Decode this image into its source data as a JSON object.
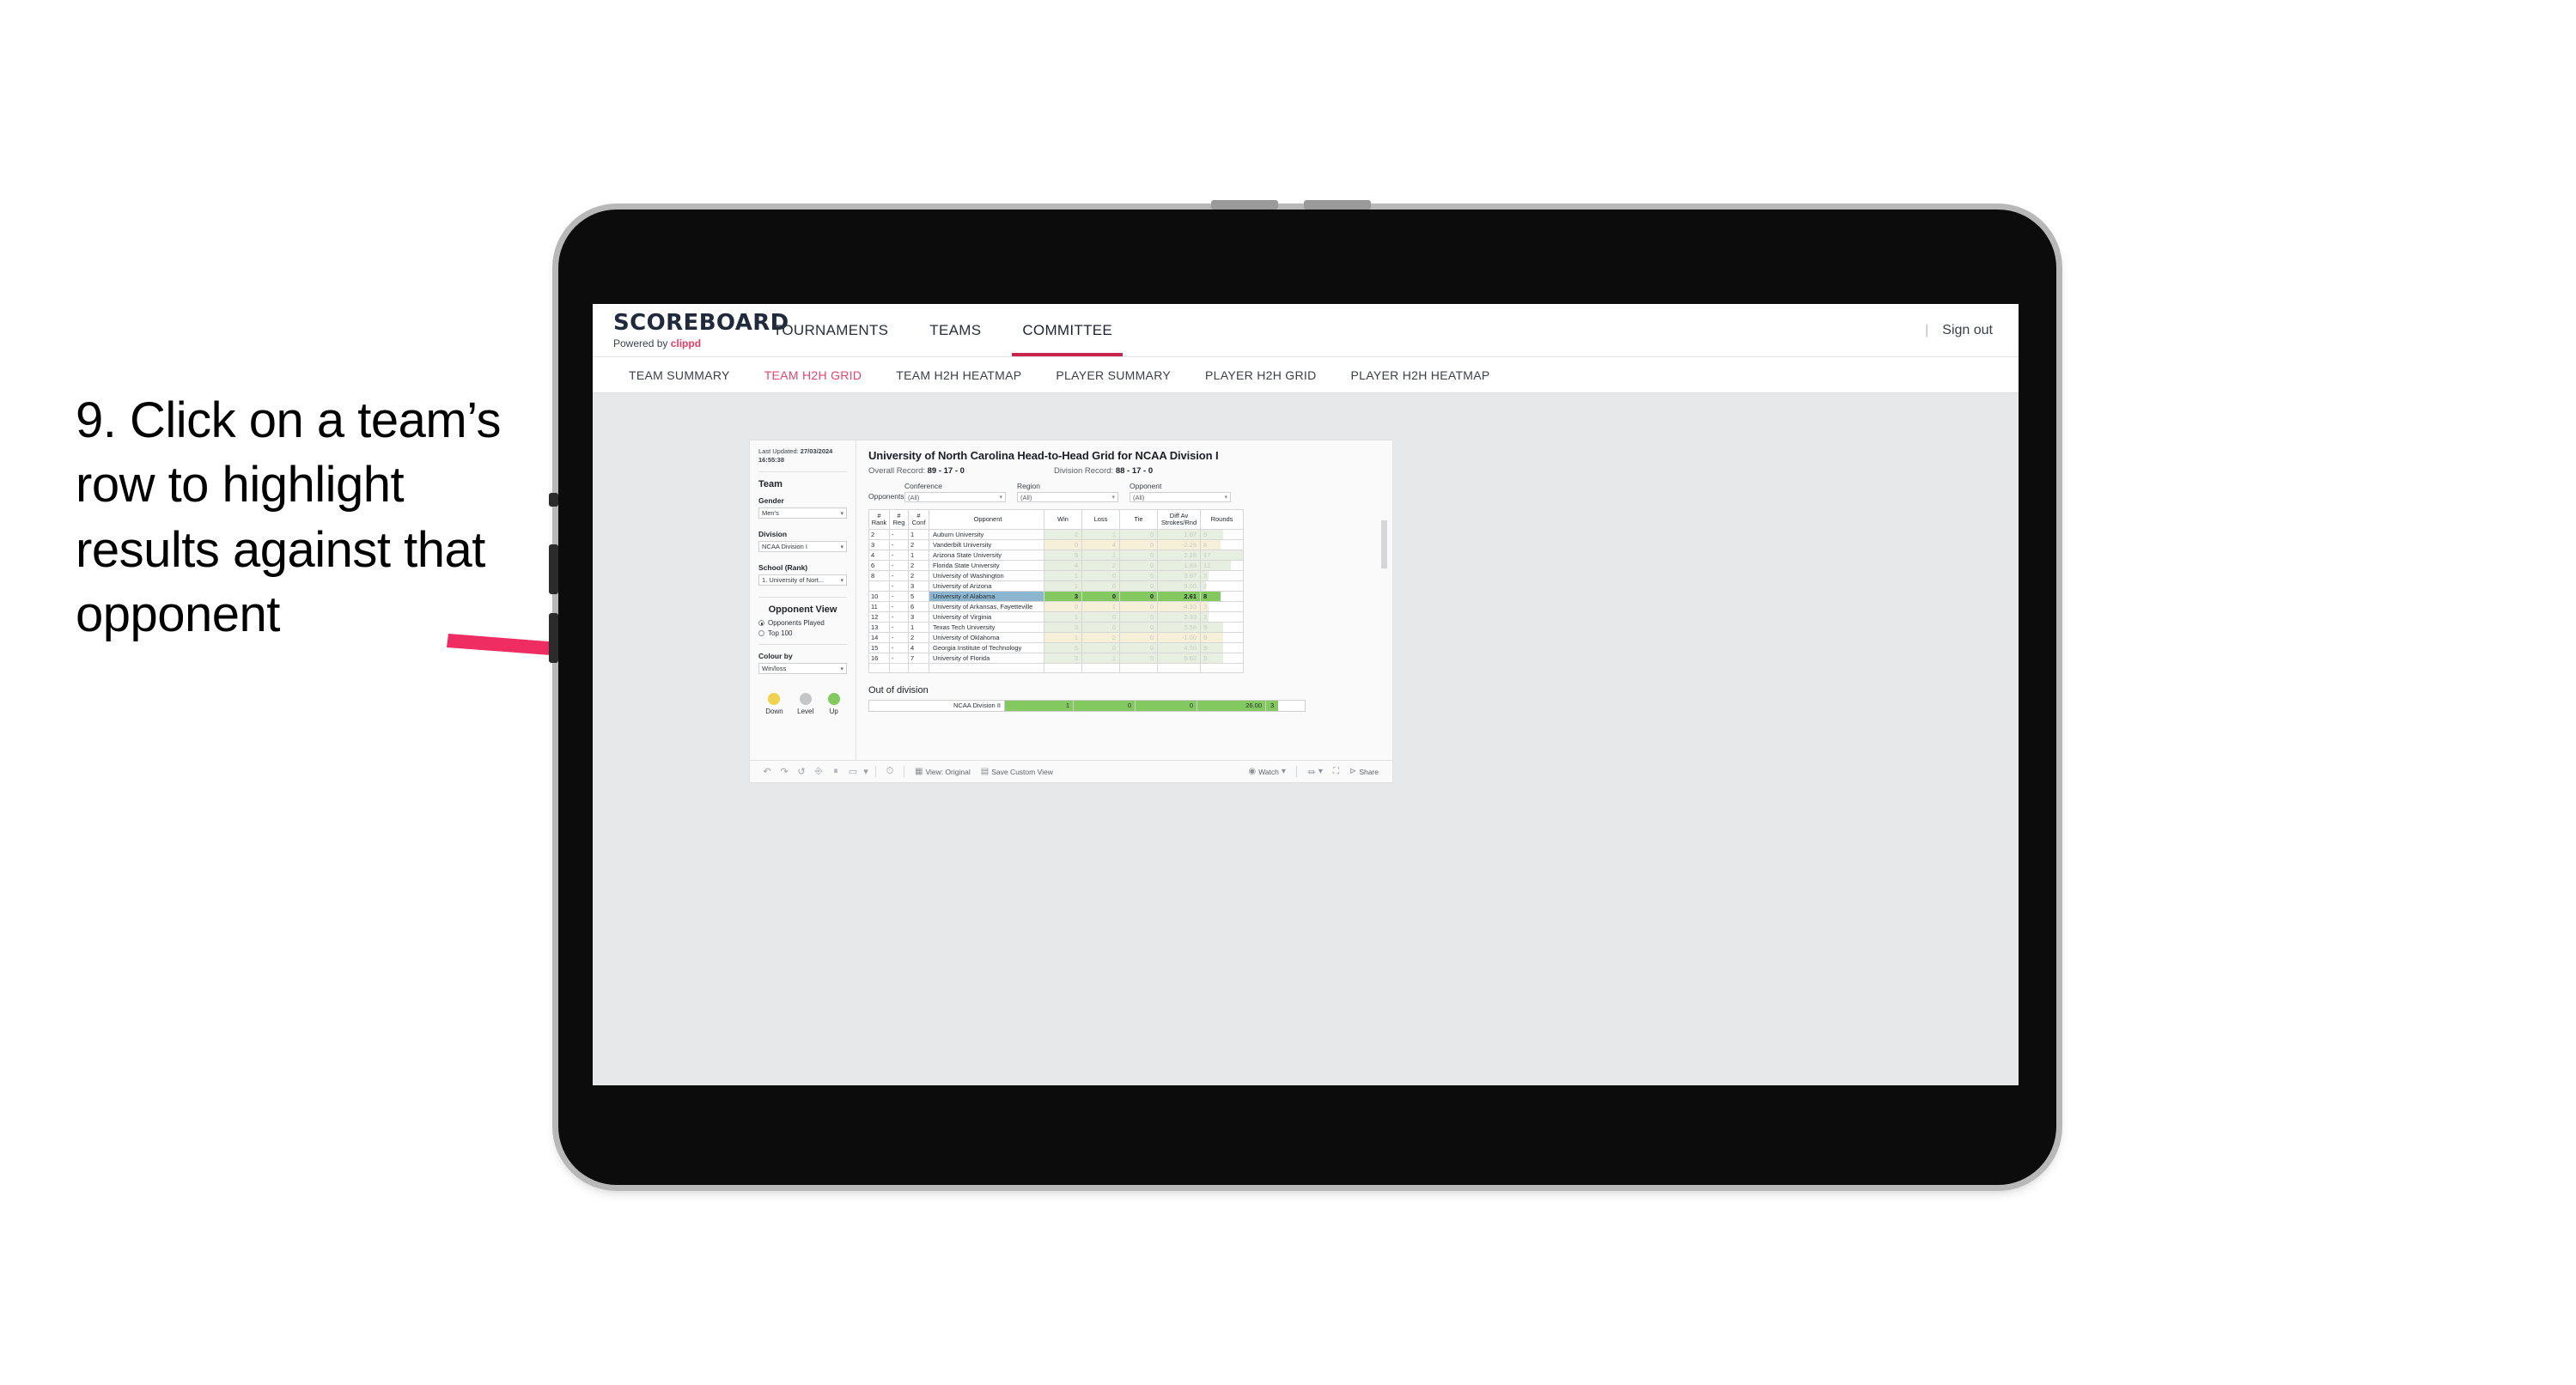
{
  "annotation": {
    "text": "9. Click on a team’s row to highlight results against that opponent",
    "arrow_color": "#ef2d63"
  },
  "appbar": {
    "brand_title": "SCOREBOARD",
    "brand_sub_prefix": "Powered by ",
    "brand_sub_name": "clippd",
    "nav": [
      {
        "label": "TOURNAMENTS",
        "active": false
      },
      {
        "label": "TEAMS",
        "active": false
      },
      {
        "label": "COMMITTEE",
        "active": true
      }
    ],
    "divider": "|",
    "sign_out": "Sign out"
  },
  "subnav": {
    "items": [
      {
        "label": "TEAM SUMMARY",
        "active": false
      },
      {
        "label": "TEAM H2H GRID",
        "active": true
      },
      {
        "label": "TEAM H2H HEATMAP",
        "active": false
      },
      {
        "label": "PLAYER SUMMARY",
        "active": false
      },
      {
        "label": "PLAYER H2H GRID",
        "active": false
      },
      {
        "label": "PLAYER H2H HEATMAP",
        "active": false
      }
    ]
  },
  "panel": {
    "last_updated_label": "Last Updated: ",
    "last_updated_value": "27/03/2024 16:55:38",
    "team_heading": "Team",
    "gender_label": "Gender",
    "gender_value": "Men’s",
    "division_label": "Division",
    "division_value": "NCAA Division I",
    "school_label": "School (Rank)",
    "school_value": "1. University of Nort...",
    "opponent_view_heading": "Opponent View",
    "opponent_view_options": [
      {
        "label": "Opponents Played",
        "selected": true
      },
      {
        "label": "Top 100",
        "selected": false
      }
    ],
    "colour_by_label": "Colour by",
    "colour_by_value": "Win/loss",
    "legend": [
      {
        "label": "Down",
        "color": "#f0d250"
      },
      {
        "label": "Level",
        "color": "#c4c6c8"
      },
      {
        "label": "Up",
        "color": "#84c860"
      }
    ]
  },
  "main": {
    "title": "University of North Carolina Head-to-Head Grid for NCAA Division I",
    "overall_record_label": "Overall Record: ",
    "overall_record_value": "89 - 17 - 0",
    "division_record_label": "Division Record: ",
    "division_record_value": "88 - 17 - 0",
    "opponents_label": "Opponents:",
    "filters": [
      {
        "label": "Conference",
        "value": "(All)"
      },
      {
        "label": "Region",
        "value": "(All)"
      },
      {
        "label": "Opponent",
        "value": "(All)"
      }
    ],
    "out_of_division_title": "Out of division"
  },
  "chart_data": {
    "type": "table",
    "title": "University of North Carolina Head-to-Head Grid for NCAA Division I",
    "columns": [
      "# Rank",
      "# Reg",
      "# Conf",
      "Opponent",
      "Win",
      "Loss",
      "Tie",
      "Diff Av Strokes/Rnd",
      "Rounds"
    ],
    "rows": [
      {
        "rank": "2",
        "reg": "-",
        "conf": "1",
        "opponent": "Auburn University",
        "win": "2",
        "loss": "1",
        "tie": "0",
        "diff": "1.67",
        "rounds": "9",
        "result": "up",
        "selected": false
      },
      {
        "rank": "3",
        "reg": "-",
        "conf": "2",
        "opponent": "Vanderbilt University",
        "win": "0",
        "loss": "4",
        "tie": "0",
        "diff": "-2.29",
        "rounds": "8",
        "result": "down",
        "selected": false
      },
      {
        "rank": "4",
        "reg": "-",
        "conf": "1",
        "opponent": "Arizona State University",
        "win": "5",
        "loss": "1",
        "tie": "0",
        "diff": "2.28",
        "rounds": "17",
        "result": "up",
        "selected": false
      },
      {
        "rank": "6",
        "reg": "-",
        "conf": "2",
        "opponent": "Florida State University",
        "win": "4",
        "loss": "2",
        "tie": "0",
        "diff": "1.83",
        "rounds": "12",
        "result": "up",
        "selected": false
      },
      {
        "rank": "8",
        "reg": "-",
        "conf": "2",
        "opponent": "University of Washington",
        "win": "1",
        "loss": "0",
        "tie": "0",
        "diff": "3.67",
        "rounds": "3",
        "result": "up",
        "selected": false
      },
      {
        "rank": "",
        "reg": "-",
        "conf": "3",
        "opponent": "University of Arizona",
        "win": "1",
        "loss": "0",
        "tie": "0",
        "diff": "9.00",
        "rounds": "2",
        "result": "up",
        "selected": false
      },
      {
        "rank": "10",
        "reg": "-",
        "conf": "5",
        "opponent": "University of Alabama",
        "win": "3",
        "loss": "0",
        "tie": "0",
        "diff": "2.61",
        "rounds": "8",
        "result": "up",
        "selected": true
      },
      {
        "rank": "11",
        "reg": "-",
        "conf": "6",
        "opponent": "University of Arkansas, Fayetteville",
        "win": "0",
        "loss": "1",
        "tie": "0",
        "diff": "-4.33",
        "rounds": "3",
        "result": "down",
        "selected": false
      },
      {
        "rank": "12",
        "reg": "-",
        "conf": "3",
        "opponent": "University of Virginia",
        "win": "1",
        "loss": "0",
        "tie": "0",
        "diff": "2.33",
        "rounds": "3",
        "result": "up",
        "selected": false
      },
      {
        "rank": "13",
        "reg": "-",
        "conf": "1",
        "opponent": "Texas Tech University",
        "win": "3",
        "loss": "0",
        "tie": "0",
        "diff": "5.56",
        "rounds": "9",
        "result": "up",
        "selected": false
      },
      {
        "rank": "14",
        "reg": "-",
        "conf": "2",
        "opponent": "University of Oklahoma",
        "win": "1",
        "loss": "2",
        "tie": "0",
        "diff": "-1.00",
        "rounds": "9",
        "result": "down",
        "selected": false
      },
      {
        "rank": "15",
        "reg": "-",
        "conf": "4",
        "opponent": "Georgia Institute of Technology",
        "win": "5",
        "loss": "0",
        "tie": "0",
        "diff": "4.50",
        "rounds": "9",
        "result": "up",
        "selected": false
      },
      {
        "rank": "16",
        "reg": "-",
        "conf": "7",
        "opponent": "University of Florida",
        "win": "3",
        "loss": "1",
        "tie": "0",
        "diff": "6.62",
        "rounds": "9",
        "result": "up",
        "selected": false
      }
    ],
    "out_of_division": [
      {
        "opponent": "NCAA Division II",
        "win": "1",
        "loss": "0",
        "tie": "0",
        "diff": "26.00",
        "rounds": "3",
        "result": "up"
      }
    ],
    "colors": {
      "up": "#84c860",
      "down": "#f0d250",
      "level": "#c4c6c8",
      "selected_row": "#8cb6d0"
    }
  },
  "toolbar": {
    "view_label": "View: Original",
    "save_label": "Save Custom View",
    "watch_label": "Watch",
    "share_label": "Share"
  }
}
